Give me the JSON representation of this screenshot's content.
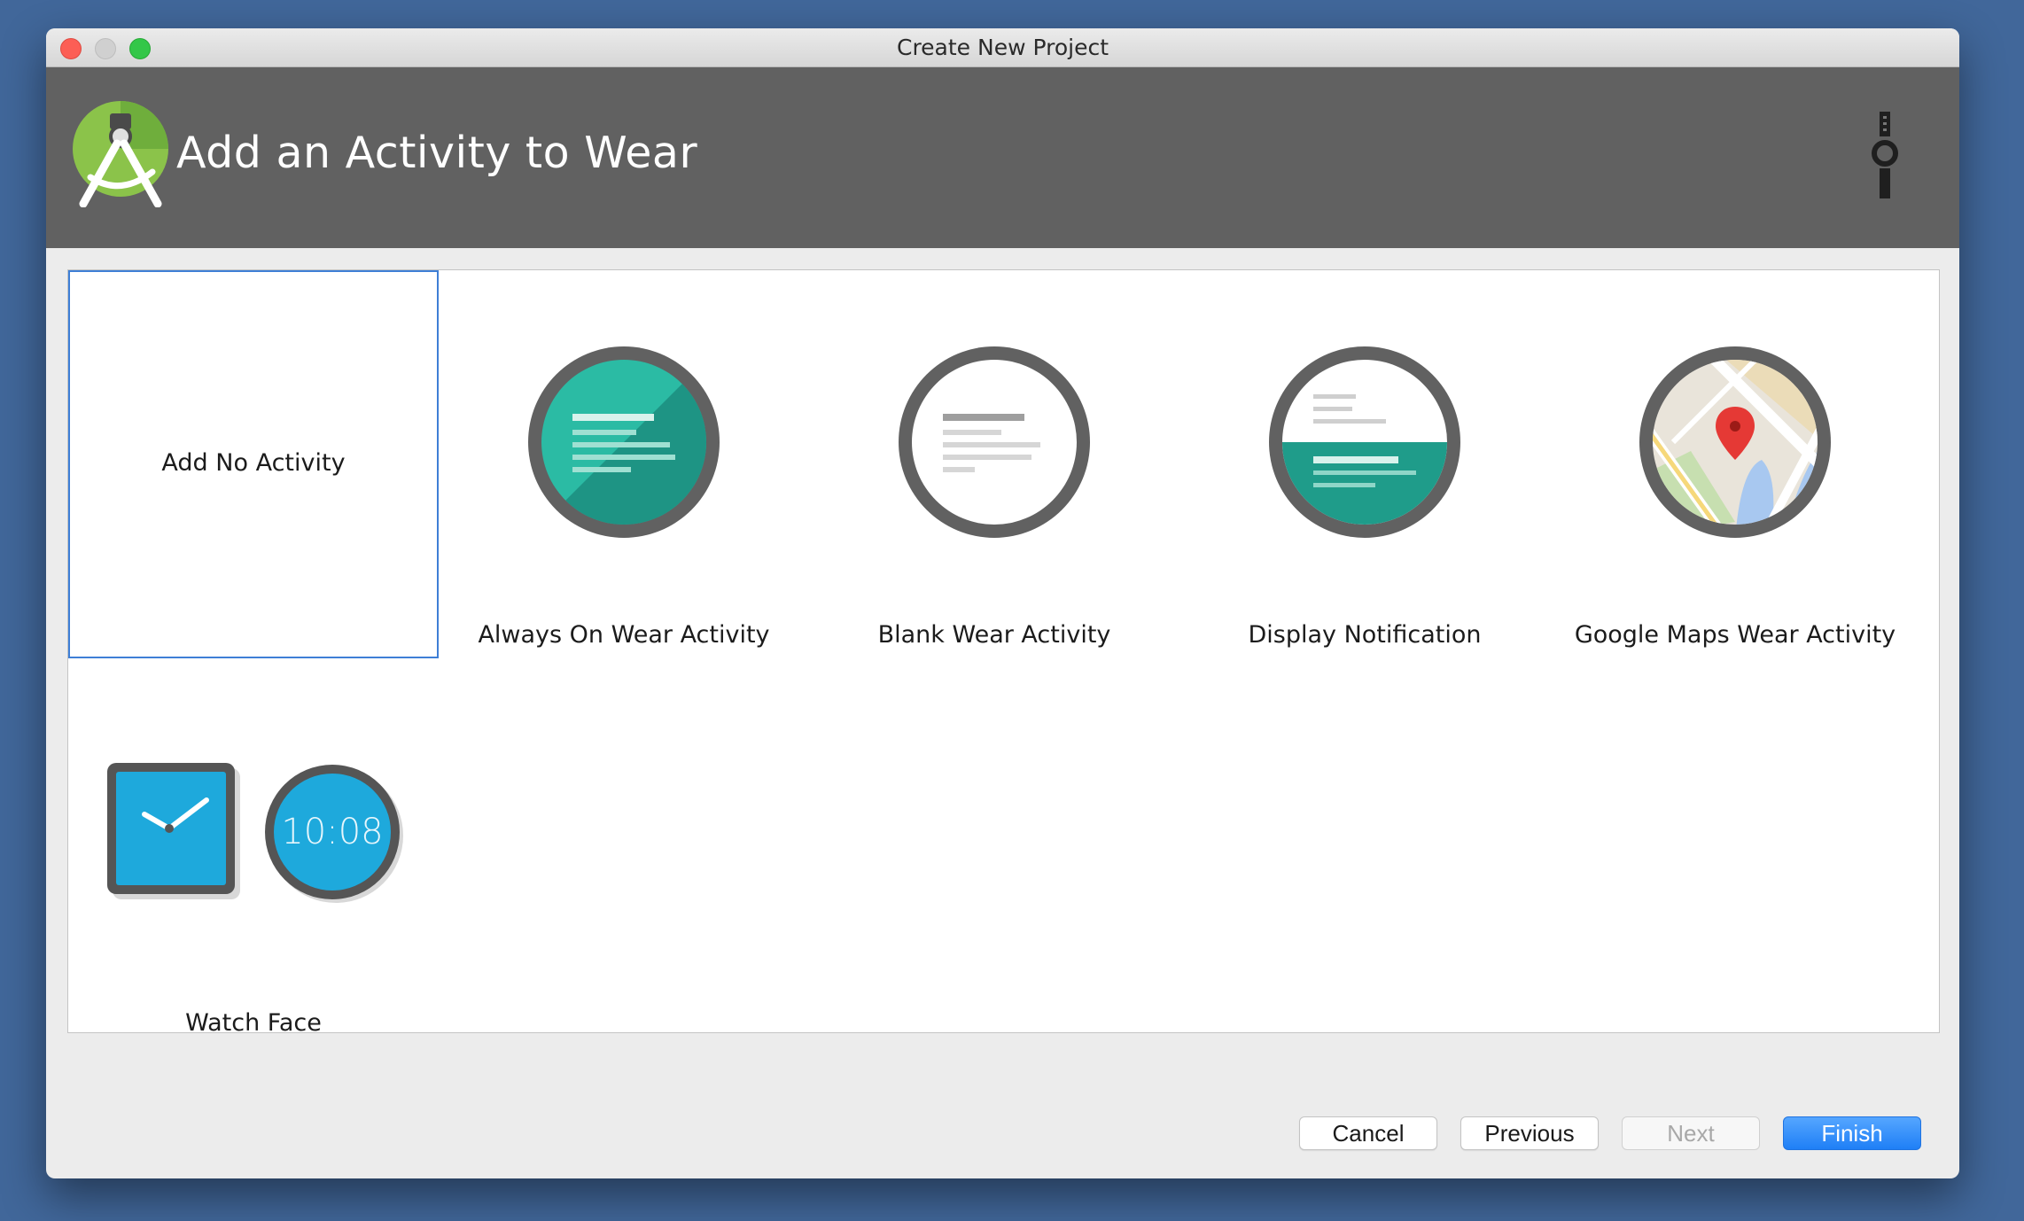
{
  "window": {
    "title": "Create New Project"
  },
  "banner": {
    "title": "Add an Activity to Wear"
  },
  "templates": [
    {
      "label": "Add No Activity",
      "selected": true
    },
    {
      "label": "Always On Wear Activity",
      "selected": false
    },
    {
      "label": "Blank Wear Activity",
      "selected": false
    },
    {
      "label": "Display Notification",
      "selected": false
    },
    {
      "label": "Google Maps Wear Activity",
      "selected": false
    },
    {
      "label": "Watch Face",
      "selected": false,
      "clock_text": "10:08"
    }
  ],
  "buttons": {
    "cancel": "Cancel",
    "previous": "Previous",
    "next": "Next",
    "finish": "Finish"
  },
  "colors": {
    "accent": "#2a84f7",
    "teal": "#1f9c8a",
    "watchface_blue": "#1ea9dc",
    "banner": "#616161"
  }
}
